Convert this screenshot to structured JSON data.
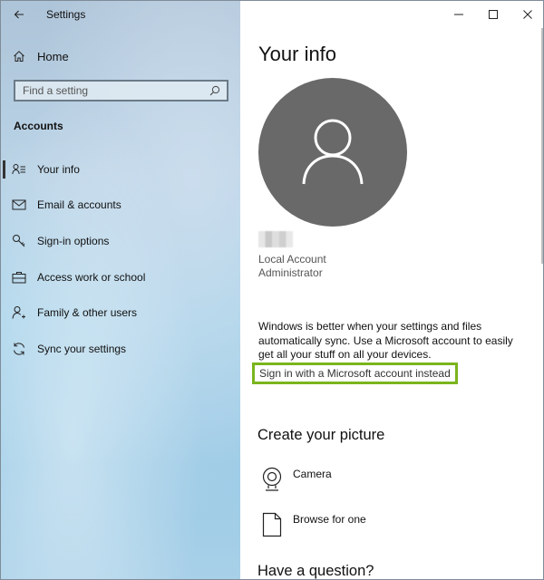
{
  "app": {
    "title": "Settings",
    "back_icon": "back-arrow-icon"
  },
  "window_controls": {
    "minimize": "—",
    "maximize": "☐",
    "close": "✕"
  },
  "sidebar": {
    "home_label": "Home",
    "search": {
      "placeholder": "Find a setting",
      "value": ""
    },
    "section_label": "Accounts",
    "items": [
      {
        "label": "Your info",
        "icon": "person-card-icon",
        "selected": true
      },
      {
        "label": "Email & accounts",
        "icon": "mail-icon",
        "selected": false
      },
      {
        "label": "Sign-in options",
        "icon": "key-icon",
        "selected": false
      },
      {
        "label": "Access work or school",
        "icon": "briefcase-icon",
        "selected": false
      },
      {
        "label": "Family & other users",
        "icon": "person-add-icon",
        "selected": false
      },
      {
        "label": "Sync your settings",
        "icon": "sync-icon",
        "selected": false
      }
    ]
  },
  "main": {
    "page_title": "Your info",
    "account_type": "Local Account",
    "account_role": "Administrator",
    "sync_text": "Windows is better when your settings and files automatically sync. Use a Microsoft account to easily get all your stuff on all your devices.",
    "signin_link": "Sign in with a Microsoft account instead",
    "create_picture_title": "Create your picture",
    "picture_options": [
      {
        "label": "Camera",
        "icon": "camera-icon"
      },
      {
        "label": "Browse for one",
        "icon": "file-icon"
      }
    ],
    "question_title": "Have a question?"
  },
  "colors": {
    "highlight_border": "#7ab51d",
    "avatar_bg": "#696969"
  }
}
